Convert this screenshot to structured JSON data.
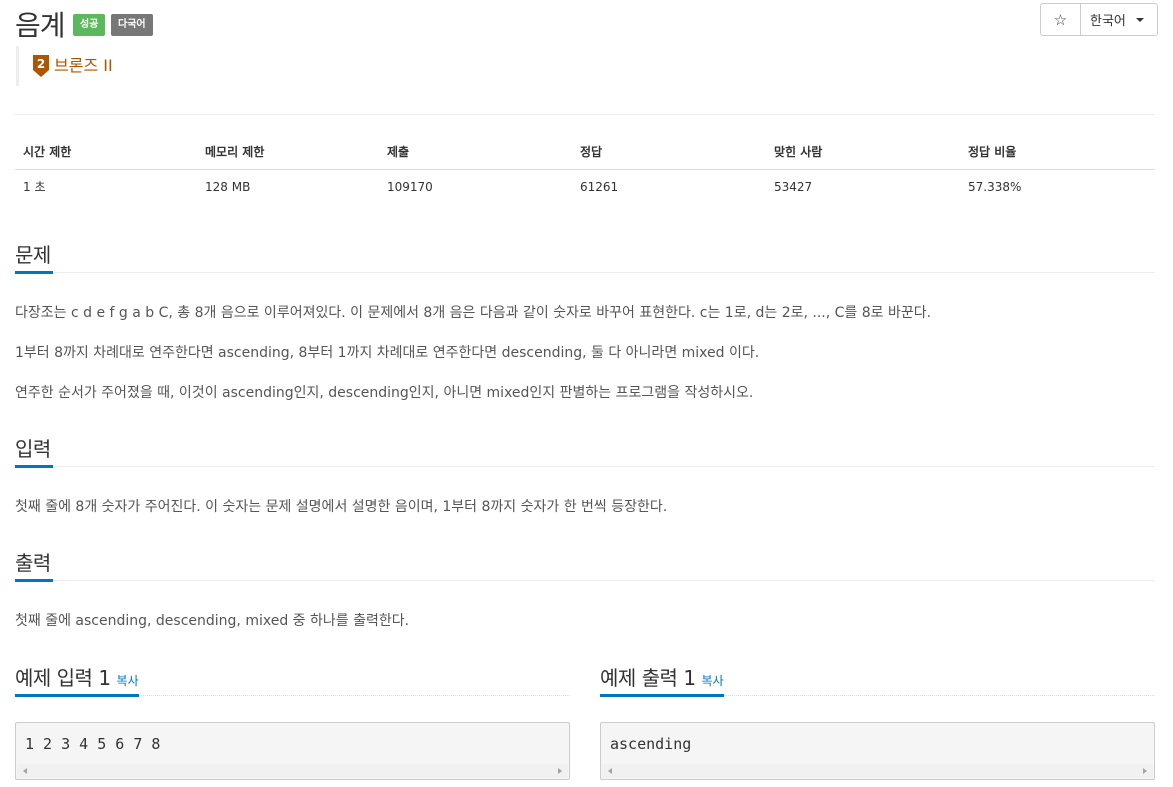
{
  "header": {
    "title": "음계",
    "badge_success": "성공",
    "badge_lang": "다국어",
    "tier_label": "브론즈 II",
    "tier_number": "2",
    "tier_color": "#ad5600",
    "star_icon": "☆",
    "language_select": "한국어"
  },
  "info_table": {
    "headers": [
      "시간 제한",
      "메모리 제한",
      "제출",
      "정답",
      "맞힌 사람",
      "정답 비율"
    ],
    "values": [
      "1 초",
      "128 MB",
      "109170",
      "61261",
      "53427",
      "57.338%"
    ]
  },
  "problem": {
    "heading": "문제",
    "paragraphs": [
      "다장조는 c d e f g a b C, 총 8개 음으로 이루어져있다. 이 문제에서 8개 음은 다음과 같이 숫자로 바꾸어 표현한다. c는 1로, d는 2로, ..., C를 8로 바꾼다.",
      "1부터 8까지 차례대로 연주한다면 ascending, 8부터 1까지 차례대로 연주한다면 descending, 둘 다 아니라면 mixed 이다.",
      "연주한 순서가 주어졌을 때, 이것이 ascending인지, descending인지, 아니면 mixed인지 판별하는 프로그램을 작성하시오."
    ]
  },
  "input": {
    "heading": "입력",
    "text": "첫째 줄에 8개 숫자가 주어진다. 이 숫자는 문제 설명에서 설명한 음이며, 1부터 8까지 숫자가 한 번씩 등장한다."
  },
  "output": {
    "heading": "출력",
    "text": "첫째 줄에 ascending, descending, mixed 중 하나를 출력한다."
  },
  "examples": {
    "input_heading": "예제 입력 1",
    "output_heading": "예제 출력 1",
    "copy_label": "복사",
    "input_text": "1 2 3 4 5 6 7 8",
    "output_text": "ascending"
  },
  "colors": {
    "accent": "#0076c0",
    "success": "#5cb85c",
    "lang_badge": "#777777"
  }
}
